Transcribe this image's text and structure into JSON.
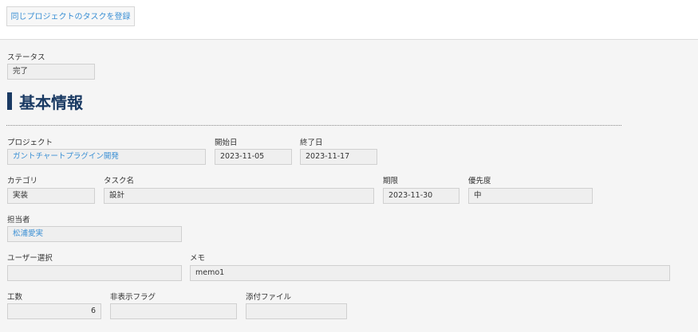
{
  "toolbar": {
    "register_same_project_label": "同じプロジェクトのタスクを登録"
  },
  "status": {
    "label": "ステータス",
    "value": "完了"
  },
  "section": {
    "title": "基本情報"
  },
  "fields": {
    "project": {
      "label": "プロジェクト",
      "value": "ガントチャートプラグイン開発"
    },
    "start": {
      "label": "開始日",
      "value": "2023-11-05"
    },
    "end": {
      "label": "終了日",
      "value": "2023-11-17"
    },
    "category": {
      "label": "カテゴリ",
      "value": "実装"
    },
    "task_name": {
      "label": "タスク名",
      "value": "設計"
    },
    "deadline": {
      "label": "期限",
      "value": "2023-11-30"
    },
    "priority": {
      "label": "優先度",
      "value": "中"
    },
    "assignee": {
      "label": "担当者",
      "value": "松浦愛実"
    },
    "user_select": {
      "label": "ユーザー選択",
      "value": ""
    },
    "memo": {
      "label": "メモ",
      "value": "memo1"
    },
    "effort": {
      "label": "工数",
      "value": "6"
    },
    "hidden_flag": {
      "label": "非表示フラグ",
      "value": ""
    },
    "attachment": {
      "label": "添付ファイル",
      "value": ""
    }
  },
  "colors": {
    "link": "#3a8fd4",
    "heading": "#1a3a63"
  }
}
